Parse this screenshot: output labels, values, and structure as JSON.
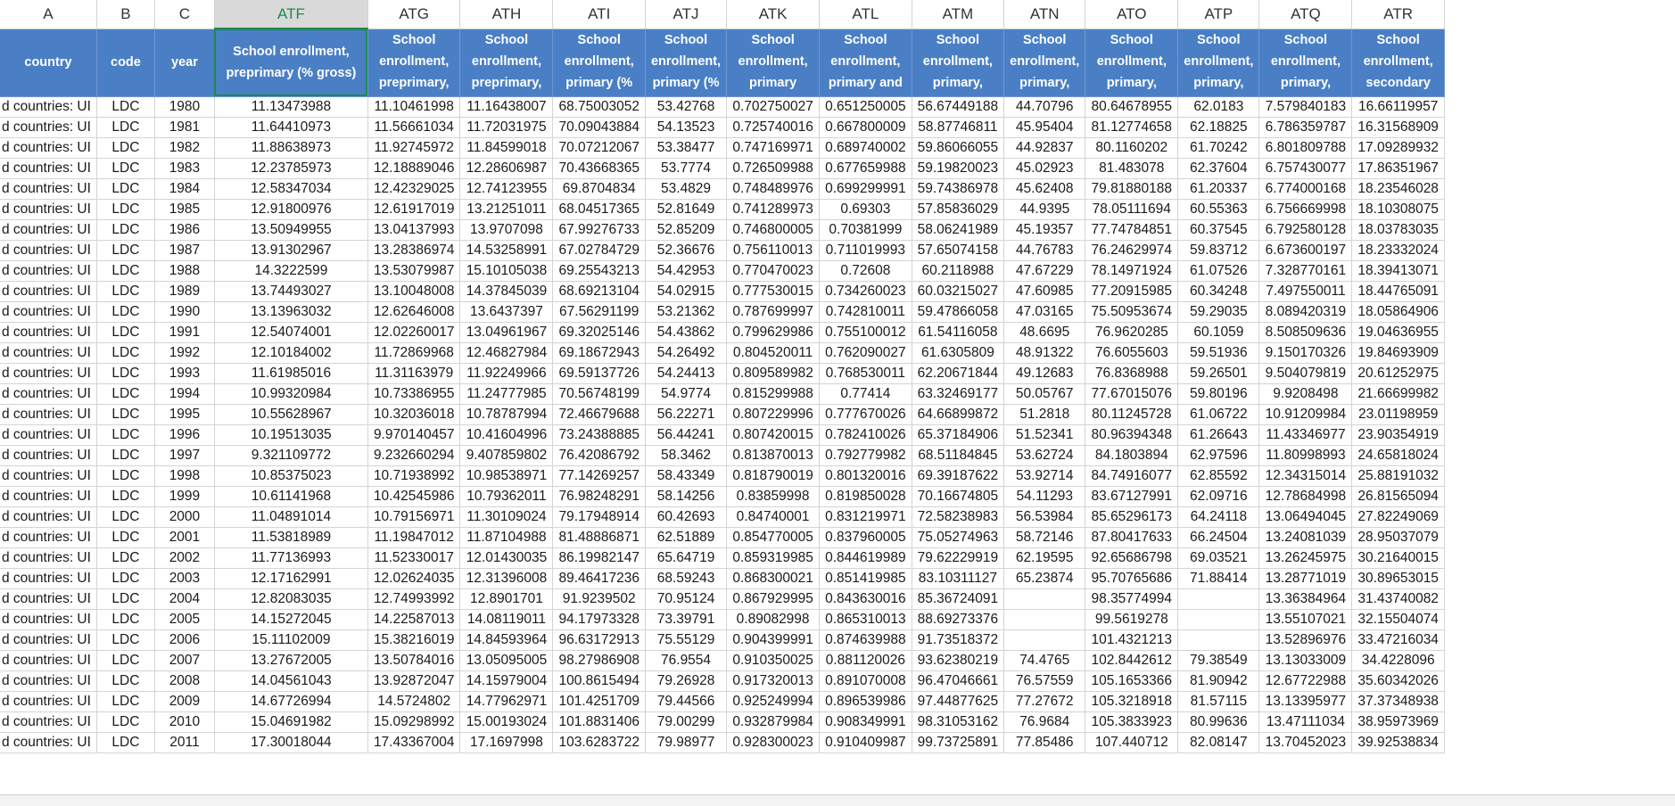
{
  "columns": [
    "A",
    "B",
    "C",
    "ATF",
    "ATG",
    "ATH",
    "ATI",
    "ATJ",
    "ATK",
    "ATL",
    "ATM",
    "ATN",
    "ATO",
    "ATP",
    "ATQ",
    "ATR"
  ],
  "headers": [
    "country",
    "code",
    "year",
    "School enrollment, preprimary (% gross)",
    "School enrollment, preprimary,",
    "School enrollment, preprimary,",
    "School enrollment, primary (%",
    "School enrollment, primary (%",
    "School enrollment, primary (gross),",
    "School enrollment, primary and",
    "School enrollment, primary, female",
    "School enrollment, primary,",
    "School enrollment, primary, male",
    "School enrollment, primary,",
    "School enrollment, primary,",
    "School enrollment, secondary (%"
  ],
  "rows": [
    [
      "d countries: UI",
      "LDC",
      "1980",
      "11.13473988",
      "11.10461998",
      "11.16438007",
      "68.75003052",
      "53.42768",
      "0.702750027",
      "0.651250005",
      "56.67449188",
      "44.70796",
      "80.64678955",
      "62.0183",
      "7.579840183",
      "16.66119957"
    ],
    [
      "d countries: UI",
      "LDC",
      "1981",
      "11.64410973",
      "11.56661034",
      "11.72031975",
      "70.09043884",
      "54.13523",
      "0.725740016",
      "0.667800009",
      "58.87746811",
      "45.95404",
      "81.12774658",
      "62.18825",
      "6.786359787",
      "16.31568909"
    ],
    [
      "d countries: UI",
      "LDC",
      "1982",
      "11.88638973",
      "11.92745972",
      "11.84599018",
      "70.07212067",
      "53.38477",
      "0.747169971",
      "0.689740002",
      "59.86066055",
      "44.92837",
      "80.1160202",
      "61.70242",
      "6.801809788",
      "17.09289932"
    ],
    [
      "d countries: UI",
      "LDC",
      "1983",
      "12.23785973",
      "12.18889046",
      "12.28606987",
      "70.43668365",
      "53.7774",
      "0.726509988",
      "0.677659988",
      "59.19820023",
      "45.02923",
      "81.483078",
      "62.37604",
      "6.757430077",
      "17.86351967"
    ],
    [
      "d countries: UI",
      "LDC",
      "1984",
      "12.58347034",
      "12.42329025",
      "12.74123955",
      "69.8704834",
      "53.4829",
      "0.748489976",
      "0.699299991",
      "59.74386978",
      "45.62408",
      "79.81880188",
      "61.20337",
      "6.774000168",
      "18.23546028"
    ],
    [
      "d countries: UI",
      "LDC",
      "1985",
      "12.91800976",
      "12.61917019",
      "13.21251011",
      "68.04517365",
      "52.81649",
      "0.741289973",
      "0.69303",
      "57.85836029",
      "44.9395",
      "78.05111694",
      "60.55363",
      "6.756669998",
      "18.10308075"
    ],
    [
      "d countries: UI",
      "LDC",
      "1986",
      "13.50949955",
      "13.04137993",
      "13.9707098",
      "67.99276733",
      "52.85209",
      "0.746800005",
      "0.70381999",
      "58.06241989",
      "45.19357",
      "77.74784851",
      "60.37545",
      "6.792580128",
      "18.03783035"
    ],
    [
      "d countries: UI",
      "LDC",
      "1987",
      "13.91302967",
      "13.28386974",
      "14.53258991",
      "67.02784729",
      "52.36676",
      "0.756110013",
      "0.711019993",
      "57.65074158",
      "44.76783",
      "76.24629974",
      "59.83712",
      "6.673600197",
      "18.23332024"
    ],
    [
      "d countries: UI",
      "LDC",
      "1988",
      "14.3222599",
      "13.53079987",
      "15.10105038",
      "69.25543213",
      "54.42953",
      "0.770470023",
      "0.72608",
      "60.2118988",
      "47.67229",
      "78.14971924",
      "61.07526",
      "7.328770161",
      "18.39413071"
    ],
    [
      "d countries: UI",
      "LDC",
      "1989",
      "13.74493027",
      "13.10048008",
      "14.37845039",
      "68.69213104",
      "54.02915",
      "0.777530015",
      "0.734260023",
      "60.03215027",
      "47.60985",
      "77.20915985",
      "60.34248",
      "7.497550011",
      "18.44765091"
    ],
    [
      "d countries: UI",
      "LDC",
      "1990",
      "13.13963032",
      "12.62646008",
      "13.6437397",
      "67.56291199",
      "53.21362",
      "0.787699997",
      "0.742810011",
      "59.47866058",
      "47.03165",
      "75.50953674",
      "59.29035",
      "8.089420319",
      "18.05864906"
    ],
    [
      "d countries: UI",
      "LDC",
      "1991",
      "12.54074001",
      "12.02260017",
      "13.04961967",
      "69.32025146",
      "54.43862",
      "0.799629986",
      "0.755100012",
      "61.54116058",
      "48.6695",
      "76.9620285",
      "60.1059",
      "8.508509636",
      "19.04636955"
    ],
    [
      "d countries: UI",
      "LDC",
      "1992",
      "12.10184002",
      "11.72869968",
      "12.46827984",
      "69.18672943",
      "54.26492",
      "0.804520011",
      "0.762090027",
      "61.6305809",
      "48.91322",
      "76.6055603",
      "59.51936",
      "9.150170326",
      "19.84693909"
    ],
    [
      "d countries: UI",
      "LDC",
      "1993",
      "11.61985016",
      "11.31163979",
      "11.92249966",
      "69.59137726",
      "54.24413",
      "0.809589982",
      "0.768530011",
      "62.20671844",
      "49.12683",
      "76.8368988",
      "59.26501",
      "9.504079819",
      "20.61252975"
    ],
    [
      "d countries: UI",
      "LDC",
      "1994",
      "10.99320984",
      "10.73386955",
      "11.24777985",
      "70.56748199",
      "54.9774",
      "0.815299988",
      "0.77414",
      "63.32469177",
      "50.05767",
      "77.67015076",
      "59.80196",
      "9.9208498",
      "21.66699982"
    ],
    [
      "d countries: UI",
      "LDC",
      "1995",
      "10.55628967",
      "10.32036018",
      "10.78787994",
      "72.46679688",
      "56.22271",
      "0.807229996",
      "0.777670026",
      "64.66899872",
      "51.2818",
      "80.11245728",
      "61.06722",
      "10.91209984",
      "23.01198959"
    ],
    [
      "d countries: UI",
      "LDC",
      "1996",
      "10.19513035",
      "9.970140457",
      "10.41604996",
      "73.24388885",
      "56.44241",
      "0.807420015",
      "0.782410026",
      "65.37184906",
      "51.52341",
      "80.96394348",
      "61.26643",
      "11.43346977",
      "23.90354919"
    ],
    [
      "d countries: UI",
      "LDC",
      "1997",
      "9.321109772",
      "9.232660294",
      "9.407859802",
      "76.42086792",
      "58.3462",
      "0.813870013",
      "0.792779982",
      "68.51184845",
      "53.62724",
      "84.1803894",
      "62.97596",
      "11.80998993",
      "24.65818024"
    ],
    [
      "d countries: UI",
      "LDC",
      "1998",
      "10.85375023",
      "10.71938992",
      "10.98538971",
      "77.14269257",
      "58.43349",
      "0.818790019",
      "0.801320016",
      "69.39187622",
      "53.92714",
      "84.74916077",
      "62.85592",
      "12.34315014",
      "25.88191032"
    ],
    [
      "d countries: UI",
      "LDC",
      "1999",
      "10.61141968",
      "10.42545986",
      "10.79362011",
      "76.98248291",
      "58.14256",
      "0.83859998",
      "0.819850028",
      "70.16674805",
      "54.11293",
      "83.67127991",
      "62.09716",
      "12.78684998",
      "26.81565094"
    ],
    [
      "d countries: UI",
      "LDC",
      "2000",
      "11.04891014",
      "10.79156971",
      "11.30109024",
      "79.17948914",
      "60.42693",
      "0.84740001",
      "0.831219971",
      "72.58238983",
      "56.53984",
      "85.65296173",
      "64.24118",
      "13.06494045",
      "27.82249069"
    ],
    [
      "d countries: UI",
      "LDC",
      "2001",
      "11.53818989",
      "11.19847012",
      "11.87104988",
      "81.48886871",
      "62.51889",
      "0.854770005",
      "0.837960005",
      "75.05274963",
      "58.72146",
      "87.80417633",
      "66.24504",
      "13.24081039",
      "28.95037079"
    ],
    [
      "d countries: UI",
      "LDC",
      "2002",
      "11.77136993",
      "11.52330017",
      "12.01430035",
      "86.19982147",
      "65.64719",
      "0.859319985",
      "0.844619989",
      "79.62229919",
      "62.19595",
      "92.65686798",
      "69.03521",
      "13.26245975",
      "30.21640015"
    ],
    [
      "d countries: UI",
      "LDC",
      "2003",
      "12.17162991",
      "12.02624035",
      "12.31396008",
      "89.46417236",
      "68.59243",
      "0.868300021",
      "0.851419985",
      "83.10311127",
      "65.23874",
      "95.70765686",
      "71.88414",
      "13.28771019",
      "30.89653015"
    ],
    [
      "d countries: UI",
      "LDC",
      "2004",
      "12.82083035",
      "12.74993992",
      "12.8901701",
      "91.9239502",
      "70.95124",
      "0.867929995",
      "0.843630016",
      "85.36724091",
      "",
      "98.35774994",
      "",
      "13.36384964",
      "31.43740082"
    ],
    [
      "d countries: UI",
      "LDC",
      "2005",
      "14.15272045",
      "14.22587013",
      "14.08119011",
      "94.17973328",
      "73.39791",
      "0.89082998",
      "0.865310013",
      "88.69273376",
      "",
      "99.5619278",
      "",
      "13.55107021",
      "32.15504074"
    ],
    [
      "d countries: UI",
      "LDC",
      "2006",
      "15.11102009",
      "15.38216019",
      "14.84593964",
      "96.63172913",
      "75.55129",
      "0.904399991",
      "0.874639988",
      "91.73518372",
      "",
      "101.4321213",
      "",
      "13.52896976",
      "33.47216034"
    ],
    [
      "d countries: UI",
      "LDC",
      "2007",
      "13.27672005",
      "13.50784016",
      "13.05095005",
      "98.27986908",
      "76.9554",
      "0.910350025",
      "0.881120026",
      "93.62380219",
      "74.4765",
      "102.8442612",
      "79.38549",
      "13.13033009",
      "34.4228096"
    ],
    [
      "d countries: UI",
      "LDC",
      "2008",
      "14.04561043",
      "13.92872047",
      "14.15979004",
      "100.8615494",
      "79.26928",
      "0.917320013",
      "0.891070008",
      "96.47046661",
      "76.57559",
      "105.1653366",
      "81.90942",
      "12.67722988",
      "35.60342026"
    ],
    [
      "d countries: UI",
      "LDC",
      "2009",
      "14.67726994",
      "14.5724802",
      "14.77962971",
      "101.4251709",
      "79.44566",
      "0.925249994",
      "0.896539986",
      "97.44877625",
      "77.27672",
      "105.3218918",
      "81.57115",
      "13.13395977",
      "37.37348938"
    ],
    [
      "d countries: UI",
      "LDC",
      "2010",
      "15.04691982",
      "15.09298992",
      "15.00193024",
      "101.8831406",
      "79.00299",
      "0.932879984",
      "0.908349991",
      "98.31053162",
      "76.9684",
      "105.3833923",
      "80.99636",
      "13.47111034",
      "38.95973969"
    ],
    [
      "d countries: UI",
      "LDC",
      "2011",
      "17.30018044",
      "17.43367004",
      "17.1697998",
      "103.6283722",
      "79.98977",
      "0.928300023",
      "0.910409987",
      "99.73725891",
      "77.85486",
      "107.440712",
      "82.08147",
      "13.70452023",
      "39.92538834"
    ]
  ]
}
